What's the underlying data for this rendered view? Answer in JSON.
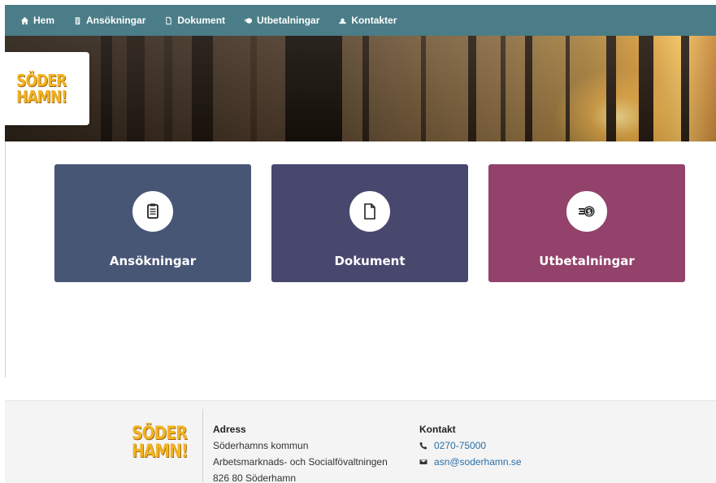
{
  "nav": {
    "items": [
      {
        "label": "Hem",
        "icon": "home-icon"
      },
      {
        "label": "Ansökningar",
        "icon": "clipboard-icon"
      },
      {
        "label": "Dokument",
        "icon": "document-icon"
      },
      {
        "label": "Utbetalningar",
        "icon": "money-icon"
      },
      {
        "label": "Kontakter",
        "icon": "person-icon"
      }
    ]
  },
  "logo": {
    "line1": "SÖDER",
    "line2": "HAMN!"
  },
  "tiles": [
    {
      "label": "Ansökningar",
      "color": "#485676",
      "icon": "clipboard-icon"
    },
    {
      "label": "Dokument",
      "color": "#48476e",
      "icon": "document-icon"
    },
    {
      "label": "Utbetalningar",
      "color": "#93426b",
      "icon": "money-icon"
    }
  ],
  "footer": {
    "address": {
      "heading": "Adress",
      "line1": "Söderhamns kommun",
      "line2": "Arbetsmarknads- och Socialfövaltningen",
      "line3": "826 80 Söderhamn"
    },
    "contact": {
      "heading": "Kontakt",
      "phone": "0270-75000",
      "email": "asn@soderhamn.se"
    }
  },
  "colors": {
    "nav_bg": "#4a7d87",
    "logo_yellow": "#f2b321",
    "link": "#2a6fa8"
  }
}
